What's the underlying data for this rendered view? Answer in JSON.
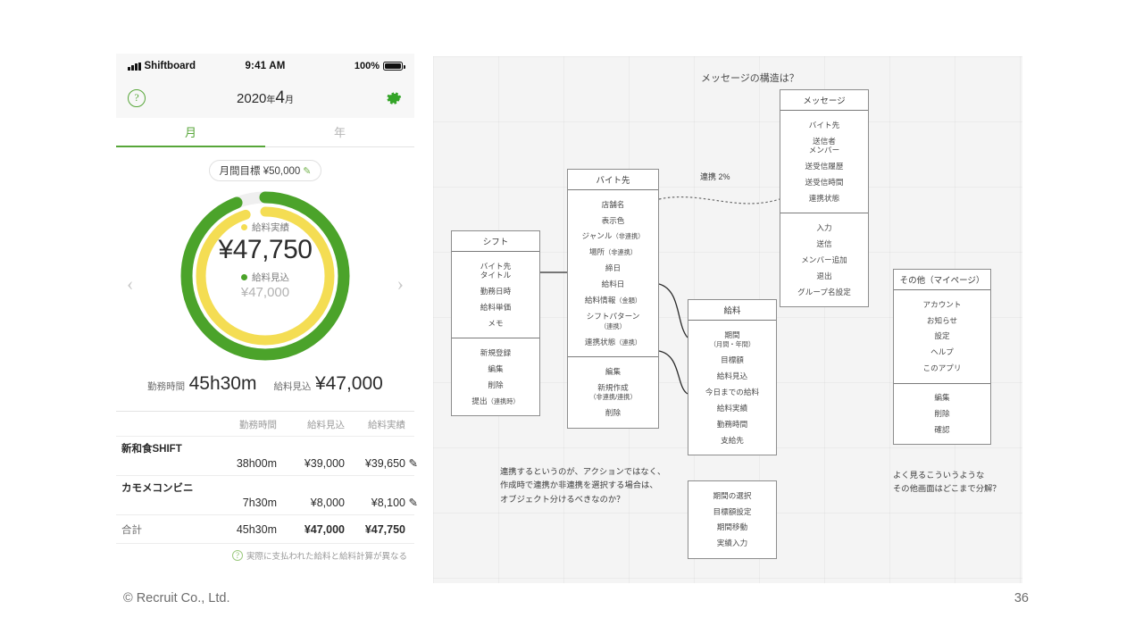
{
  "slide": {
    "copyright": "© Recruit Co., Ltd.",
    "page_number": "36",
    "background": "#ffffff"
  },
  "phone": {
    "status_bar": {
      "carrier": "Shiftboard",
      "signal_icon": "signal-bars-icon",
      "time": "9:41 AM",
      "battery_percent": "100%",
      "battery_icon": "battery-full-icon"
    },
    "nav_bar": {
      "help_icon": "question-mark-icon",
      "title_year": "2020",
      "title_year_unit": "年",
      "title_month": "4",
      "title_month_unit": "月",
      "settings_icon": "gear-icon",
      "accent": "#57a639"
    },
    "tabs": [
      {
        "label": "月",
        "active": true
      },
      {
        "label": "年",
        "active": false
      }
    ],
    "goal": {
      "label": "月間目標 ¥50,000",
      "edit_icon": "pencil-icon"
    },
    "ring": {
      "prev_icon": "chevron-left-icon",
      "next_icon": "chevron-right-icon",
      "actual_legend": "給料実績",
      "actual_value": "¥47,750",
      "actual_color": "#f4dd53",
      "expected_legend": "給料見込",
      "expected_value": "¥47,000",
      "expected_color": "#4ba32a",
      "track_color": "#efefef"
    },
    "totals": {
      "hours_label": "勤務時間",
      "hours_value": "45h30m",
      "expected_label": "給料見込",
      "expected_value": "¥47,000"
    },
    "table": {
      "headers": [
        "",
        "勤務時間",
        "給料見込",
        "給料実績",
        ""
      ],
      "rows": [
        {
          "name": "新和食SHIFT",
          "hours": "38h00m",
          "expected": "¥39,000",
          "actual": "¥39,650",
          "edit_icon": "pencil-icon"
        },
        {
          "name": "カモメコンビニ",
          "hours": "7h30m",
          "expected": "¥8,000",
          "actual": "¥8,100",
          "edit_icon": "pencil-icon"
        }
      ],
      "total": {
        "name": "合計",
        "hours": "45h30m",
        "expected": "¥47,000",
        "actual": "¥47,750"
      },
      "note": "実際に支払われた給料と給料計算が異なる",
      "note_icon": "question-mark-icon"
    }
  },
  "diagram": {
    "title": "メッセージの構造は？",
    "link_label": "連携 2%",
    "boxes": [
      {
        "id": "shift",
        "header": "シフト",
        "attributes": [
          "バイト先\nタイトル",
          "勤務日時",
          "給料単価",
          "メモ"
        ],
        "actions": [
          "新規登録",
          "編集",
          "削除",
          "提出（連携時）"
        ]
      },
      {
        "id": "workplace",
        "header": "バイト先",
        "attributes": [
          "店舗名",
          "表示色",
          "ジャンル（非連携）",
          "場所（非連携）",
          "締日",
          "給料日",
          "給料情報（金額）",
          "シフトパターン\n（連携）",
          "連携状態（連携）"
        ],
        "actions": [
          "編集",
          "新規作成\n（非連携/連携）",
          "削除"
        ]
      },
      {
        "id": "salary",
        "header": "給料",
        "attributes": [
          "期間\n（月間・年間）",
          "目標額",
          "給料見込",
          "今日までの給料",
          "給料実績",
          "勤務時間",
          "支給先"
        ],
        "actions": [
          "期間の選択",
          "目標額設定",
          "期間移動",
          "実績入力"
        ]
      },
      {
        "id": "message",
        "header": "メッセージ",
        "attributes": [
          "バイト先",
          "送信者\nメンバー",
          "送受信履歴",
          "送受信時間",
          "連携状態"
        ],
        "actions": [
          "入力",
          "送信",
          "メンバー追加",
          "退出",
          "グループ名設定"
        ]
      },
      {
        "id": "other",
        "header": "その他（マイページ）",
        "attributes": [
          "アカウント",
          "お知らせ",
          "設定",
          "ヘルプ",
          "このアプリ"
        ],
        "actions": [
          "編集",
          "削除",
          "確認"
        ]
      }
    ],
    "notes": [
      "連携するというのが、アクションではなく、\n作成時で連携か非連携を選択する場合は、\nオブジェクト分けるべきなのか？",
      "よく見るこういうような\nその他画面はどこまで分解？"
    ]
  }
}
